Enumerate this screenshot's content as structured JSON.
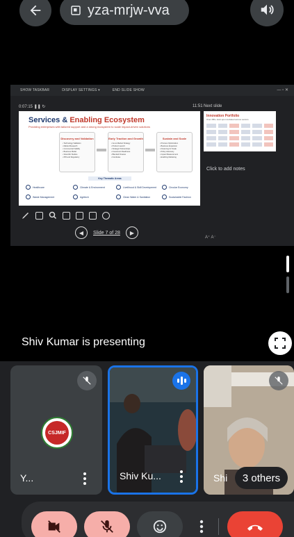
{
  "header": {
    "meeting_code": "yza-mrjw-vva",
    "back_icon": "arrow-left-icon",
    "audio_icon": "speaker-icon"
  },
  "presentation": {
    "toolbar": [
      "SHOW TASKBAR",
      "DISPLAY SETTINGS ▾",
      "END SLIDE SHOW"
    ],
    "timer": "0:07:15",
    "clock": "11:51",
    "next_slide_label": "Next slide",
    "notes_placeholder": "Click to add notes",
    "slide_counter": "Slide 7 of 28",
    "slide": {
      "title_part1": "Services & ",
      "title_part2": "Enabling Ecosystem",
      "subtitle": "Providing enterprises with tailored support and a strong ecosystem to scale impact-driven solutions",
      "cards": [
        {
          "title": "Discovery and Validation",
          "lines": "• Technology Validation\n• Market Research\n• Commercial Viability\n• Business Model\n• Scientific Studies\n• IPR and Regulatory"
        },
        {
          "title": "Early Traction and Growth",
          "lines": "• Go-to-Market Strategy\n• Product Launch\n• Strategic Partnerships\n• Investment Readiness\n• Blended Finance\n• Fundraise"
        },
        {
          "title": "Sustain and Scale",
          "lines": "• Process Optimization\n• Business Expansion\n• Financing for Scale\n• Policy Advocacy\n• Impact Measurement\n• Enabling Marketing"
        }
      ],
      "thematic_label": "Key Thematic Areas",
      "areas": [
        "Healthcare",
        "Climate & Environment",
        "Livelihood & Skill Development",
        "Circular Economy",
        "Waste Management",
        "Agritech",
        "Clean Water & Sanitation",
        "Sustainable Fashion"
      ]
    },
    "next_thumb_title": "Innovation Portfolio",
    "next_thumb_sub": "Over 280+ start-ups incubated across sectors"
  },
  "stage": {
    "presenting_text": "Shiv Kumar is presenting"
  },
  "participants": [
    {
      "name": "Y...",
      "muted": true,
      "logo_text": "CSJMIF"
    },
    {
      "name": "Shiv Ku...",
      "speaking": true
    },
    {
      "name": "Shi",
      "muted": true
    }
  ],
  "others_label": "3 others",
  "controls": {
    "camera": "camera-off-icon",
    "mic": "mic-off-icon",
    "reactions": "emoji-icon",
    "more": "more-vert-icon",
    "end_call": "end-call-icon"
  },
  "colors": {
    "accent_blue": "#1a73e8",
    "end_call_red": "#ea4335",
    "muted_pink": "#f6aea9"
  }
}
